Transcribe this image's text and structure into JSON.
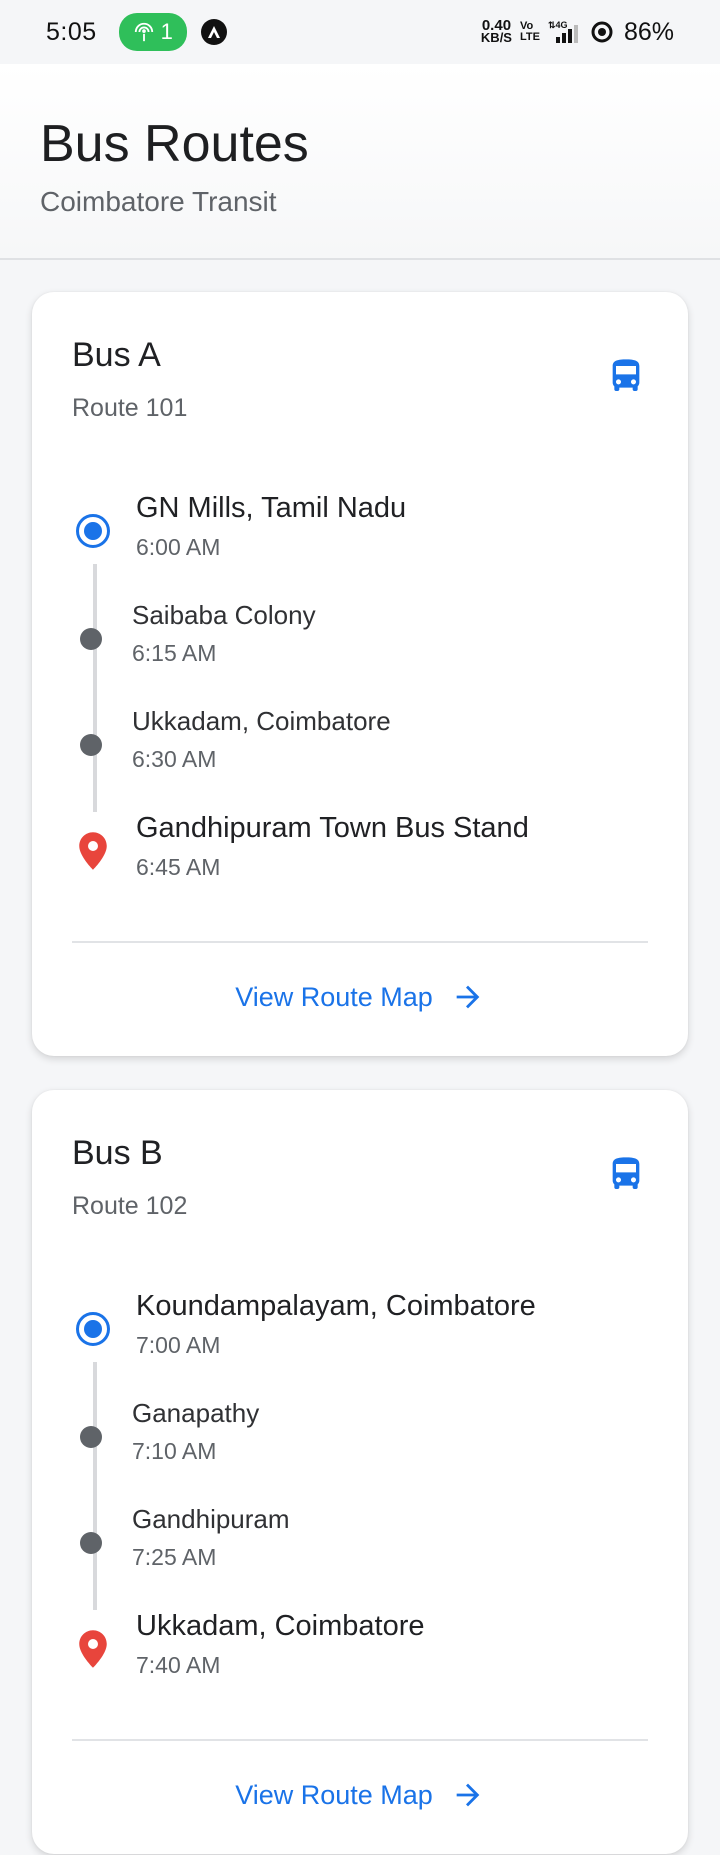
{
  "status_bar": {
    "time": "5:05",
    "hotspot_count": "1",
    "net_speed_value": "0.40",
    "net_speed_unit": "KB/S",
    "volte_top": "Vo",
    "volte_bottom": "LTE",
    "network": "4G",
    "battery": "86%"
  },
  "header": {
    "title": "Bus Routes",
    "subtitle": "Coimbatore Transit"
  },
  "colors": {
    "accent": "#1a73e8",
    "destination": "#e8453c",
    "intermediate": "#5f6368",
    "hotspot": "#2fbf5a"
  },
  "buses": [
    {
      "name": "Bus A",
      "route": "Route 101",
      "icon": "bus-icon",
      "stops": [
        {
          "name": "GN Mills, Tamil Nadu",
          "time": "6:00 AM",
          "type": "origin"
        },
        {
          "name": "Saibaba Colony",
          "time": "6:15 AM",
          "type": "intermediate"
        },
        {
          "name": "Ukkadam, Coimbatore",
          "time": "6:30 AM",
          "type": "intermediate"
        },
        {
          "name": "Gandhipuram Town Bus Stand",
          "time": "6:45 AM",
          "type": "destination"
        }
      ],
      "link_label": "View Route Map"
    },
    {
      "name": "Bus B",
      "route": "Route 102",
      "icon": "bus-icon",
      "stops": [
        {
          "name": "Koundampalayam, Coimbatore",
          "time": "7:00 AM",
          "type": "origin"
        },
        {
          "name": "Ganapathy",
          "time": "7:10 AM",
          "type": "intermediate"
        },
        {
          "name": "Gandhipuram",
          "time": "7:25 AM",
          "type": "intermediate"
        },
        {
          "name": "Ukkadam, Coimbatore",
          "time": "7:40 AM",
          "type": "destination"
        }
      ],
      "link_label": "View Route Map"
    }
  ]
}
